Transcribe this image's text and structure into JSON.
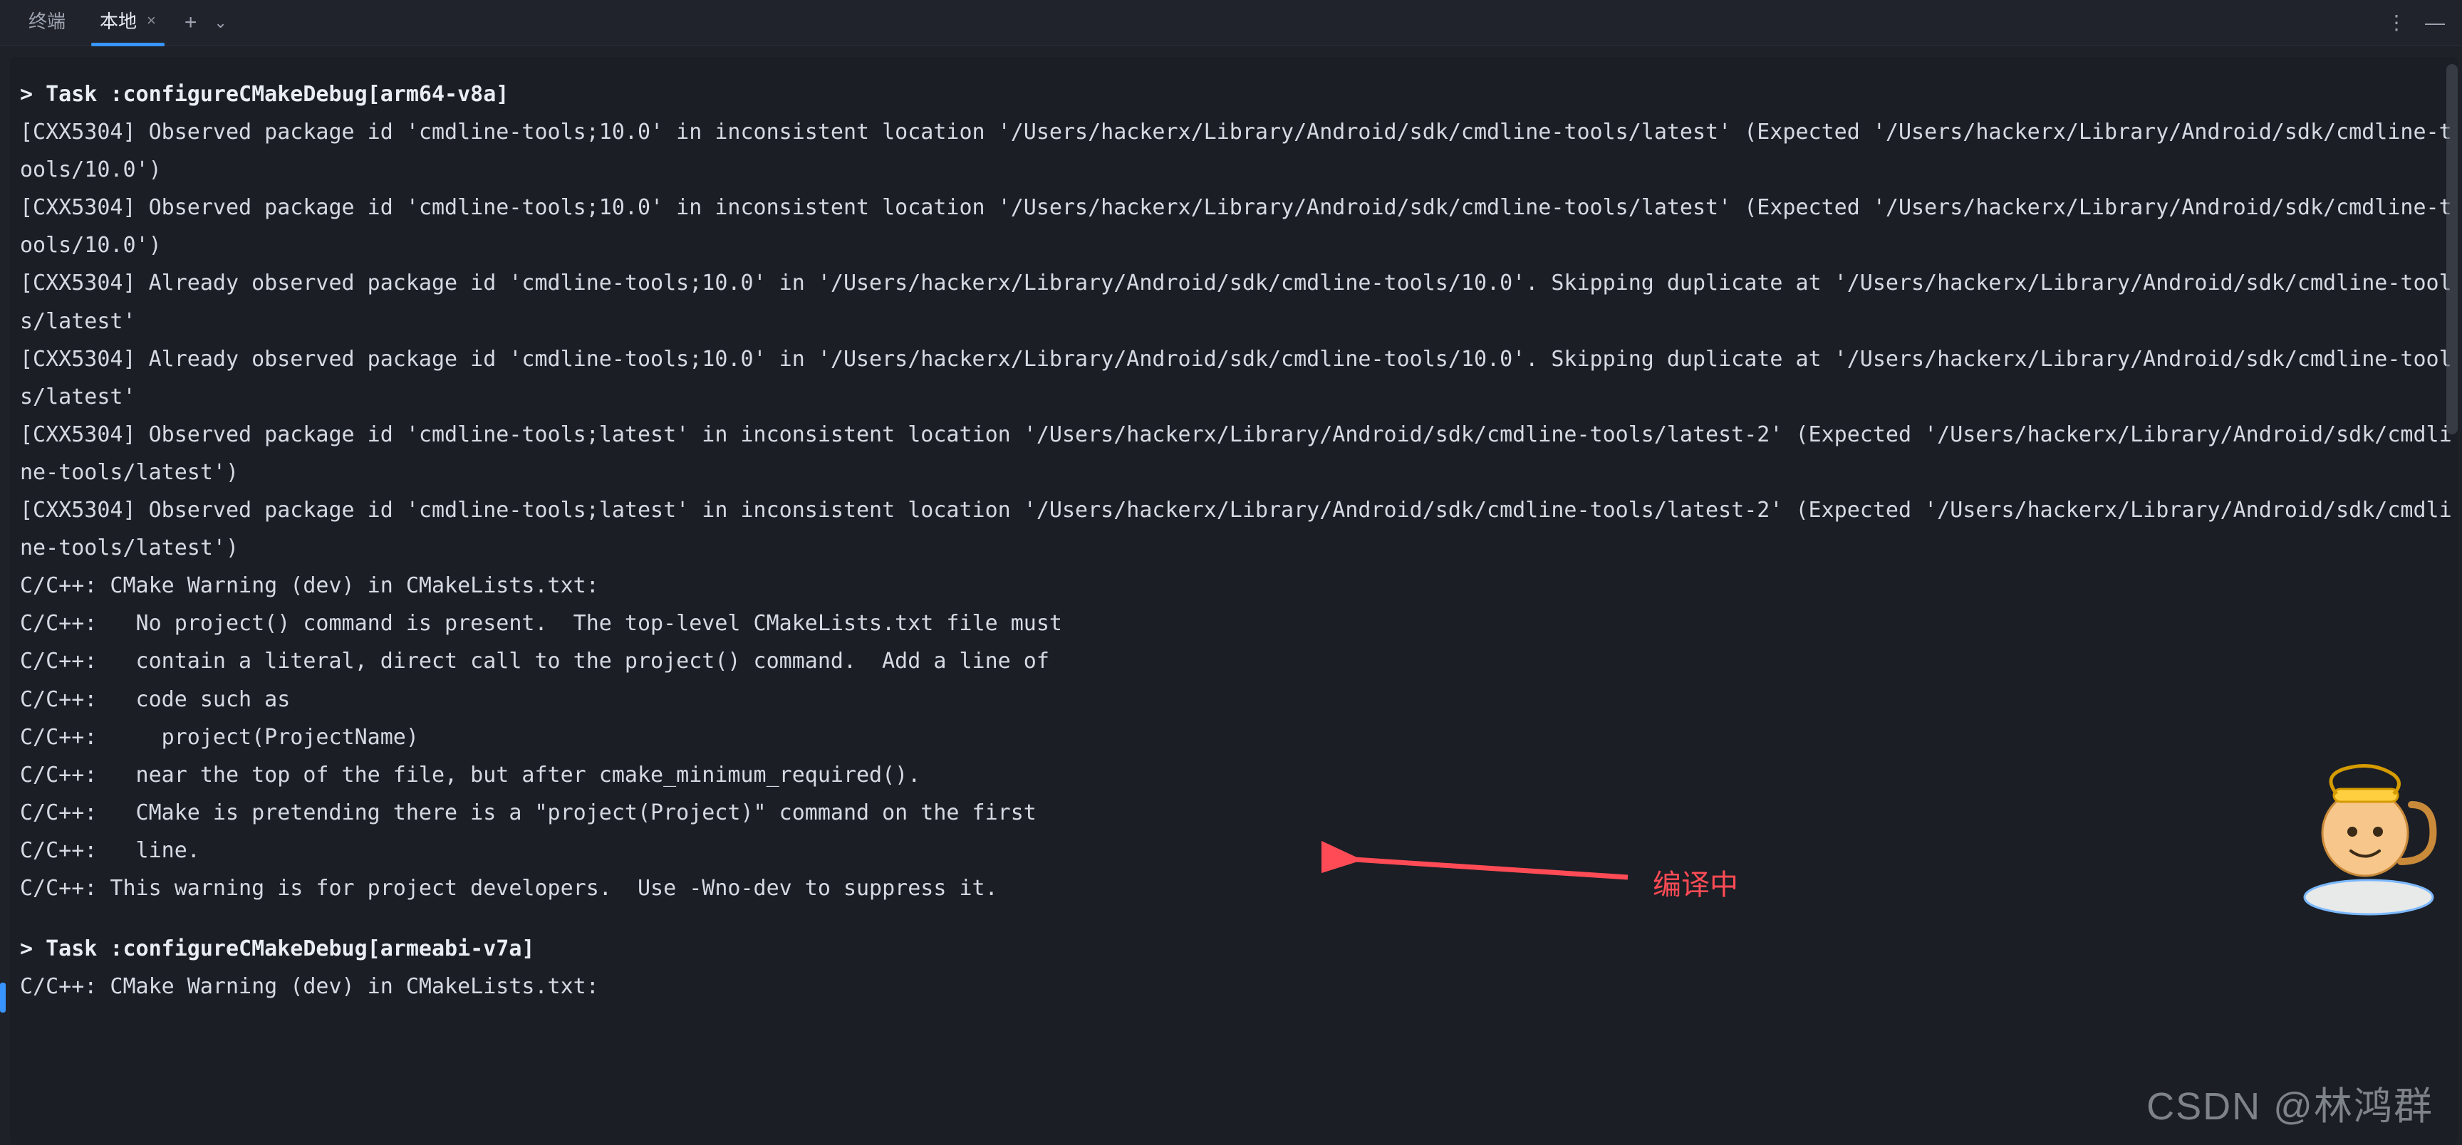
{
  "tabs": {
    "terminal_label": "终端",
    "local_label": "本地",
    "add_label": "+",
    "chevron_label": "⌄"
  },
  "titlebar": {
    "menu": "⋮",
    "minimize": "—"
  },
  "terminal": {
    "lines": [
      {
        "class": "task",
        "text": "> Task :configureCMakeDebug[arm64-v8a]"
      },
      {
        "class": "",
        "text": "[CXX5304] Observed package id 'cmdline-tools;10.0' in inconsistent location '/Users/hackerx/Library/Android/sdk/cmdline-tools/latest' (Expected '/Users/hackerx/Library/Android/sdk/cmdline-tools/10.0')"
      },
      {
        "class": "",
        "text": "[CXX5304] Observed package id 'cmdline-tools;10.0' in inconsistent location '/Users/hackerx/Library/Android/sdk/cmdline-tools/latest' (Expected '/Users/hackerx/Library/Android/sdk/cmdline-tools/10.0')"
      },
      {
        "class": "",
        "text": "[CXX5304] Already observed package id 'cmdline-tools;10.0' in '/Users/hackerx/Library/Android/sdk/cmdline-tools/10.0'. Skipping duplicate at '/Users/hackerx/Library/Android/sdk/cmdline-tools/latest'"
      },
      {
        "class": "",
        "text": "[CXX5304] Already observed package id 'cmdline-tools;10.0' in '/Users/hackerx/Library/Android/sdk/cmdline-tools/10.0'. Skipping duplicate at '/Users/hackerx/Library/Android/sdk/cmdline-tools/latest'"
      },
      {
        "class": "",
        "text": "[CXX5304] Observed package id 'cmdline-tools;latest' in inconsistent location '/Users/hackerx/Library/Android/sdk/cmdline-tools/latest-2' (Expected '/Users/hackerx/Library/Android/sdk/cmdline-tools/latest')"
      },
      {
        "class": "",
        "text": "[CXX5304] Observed package id 'cmdline-tools;latest' in inconsistent location '/Users/hackerx/Library/Android/sdk/cmdline-tools/latest-2' (Expected '/Users/hackerx/Library/Android/sdk/cmdline-tools/latest')"
      },
      {
        "class": "",
        "text": "C/C++: CMake Warning (dev) in CMakeLists.txt:"
      },
      {
        "class": "",
        "text": "C/C++:   No project() command is present.  The top-level CMakeLists.txt file must"
      },
      {
        "class": "",
        "text": "C/C++:   contain a literal, direct call to the project() command.  Add a line of"
      },
      {
        "class": "",
        "text": "C/C++:   code such as"
      },
      {
        "class": "",
        "text": "C/C++:     project(ProjectName)"
      },
      {
        "class": "",
        "text": "C/C++:   near the top of the file, but after cmake_minimum_required()."
      },
      {
        "class": "",
        "text": "C/C++:   CMake is pretending there is a \"project(Project)\" command on the first"
      },
      {
        "class": "",
        "text": "C/C++:   line."
      },
      {
        "class": "",
        "text": "C/C++: This warning is for project developers.  Use -Wno-dev to suppress it."
      },
      {
        "class": "blank",
        "text": ""
      },
      {
        "class": "task",
        "text": "> Task :configureCMakeDebug[armeabi-v7a]"
      },
      {
        "class": "",
        "text": "C/C++: CMake Warning (dev) in CMakeLists.txt:"
      }
    ]
  },
  "annotation": {
    "label": "编译中"
  },
  "watermark": {
    "text": "CSDN @林鸿群"
  },
  "colors": {
    "background": "#1e2128",
    "terminal_bg": "#1b1e25",
    "text": "#d5dae2",
    "accent": "#3895ff",
    "annotation": "#ff4b55"
  }
}
